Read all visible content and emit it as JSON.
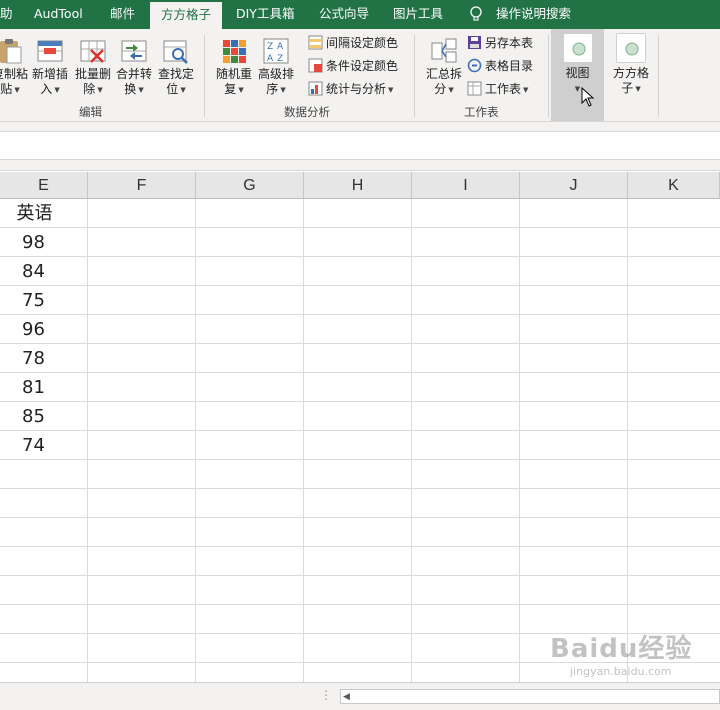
{
  "tabs": [
    {
      "label": "助",
      "active": false
    },
    {
      "label": "AudTool",
      "active": false
    },
    {
      "label": "邮件",
      "active": false
    },
    {
      "label": "方方格子",
      "active": true
    },
    {
      "label": "DIY工具箱",
      "active": false
    },
    {
      "label": "公式向导",
      "active": false
    },
    {
      "label": "图片工具",
      "active": false
    },
    {
      "label": "操作说明搜索",
      "active": false
    }
  ],
  "ribbon": {
    "edit_group": {
      "label": "编辑",
      "buttons": [
        {
          "line1": "复制粘",
          "line2": "贴",
          "icon": "paste-icon"
        },
        {
          "line1": "新增插",
          "line2": "入",
          "icon": "insert-icon"
        },
        {
          "line1": "批量删",
          "line2": "除",
          "icon": "delete-icon"
        },
        {
          "line1": "合并转",
          "line2": "换",
          "icon": "merge-convert-icon"
        },
        {
          "line1": "查找定",
          "line2": "位",
          "icon": "find-locate-icon"
        }
      ]
    },
    "analysis_group": {
      "label": "数据分析",
      "buttons": [
        {
          "line1": "随机重",
          "line2": "复",
          "icon": "random-icon"
        },
        {
          "line1": "高级排",
          "line2": "序",
          "icon": "sort-icon"
        }
      ],
      "small_buttons": [
        {
          "label": "间隔设定颜色",
          "icon": "interval-color-icon"
        },
        {
          "label": "条件设定颜色",
          "icon": "condition-color-icon"
        },
        {
          "label": "统计与分析",
          "icon": "statistics-icon"
        }
      ]
    },
    "sheet_group": {
      "label": "工作表",
      "buttons": [
        {
          "line1": "汇总拆",
          "line2": "分",
          "icon": "summary-split-icon"
        }
      ],
      "small_buttons": [
        {
          "label": "另存本表",
          "icon": "save-sheet-icon"
        },
        {
          "label": "表格目录",
          "icon": "sheet-directory-icon"
        },
        {
          "label": "工作表",
          "icon": "worksheet-icon"
        }
      ]
    },
    "view_button": {
      "line1": "视图",
      "icon": "view-icon"
    },
    "fangfang_button": {
      "line1": "方方格",
      "line2": "子",
      "icon": "fangfang-icon"
    }
  },
  "columns": [
    "E",
    "F",
    "G",
    "H",
    "I",
    "J",
    "K"
  ],
  "column_e": {
    "header_cell": "英语",
    "values": [
      "98",
      "84",
      "75",
      "96",
      "78",
      "81",
      "85",
      "74"
    ]
  },
  "watermark": {
    "big": "Baidu经验",
    "small": "jingyan.baidu.com"
  }
}
